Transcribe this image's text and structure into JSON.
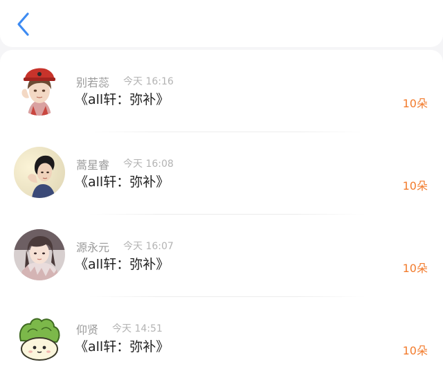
{
  "header": {
    "back_icon": "chevron-left-icon",
    "accent_color": "#3d8bf2"
  },
  "items": [
    {
      "name": "别若蕊",
      "time": "今天 16:16",
      "title": "《all轩：弥补》",
      "amount": "10朵",
      "avatar_icon": "avatar-boy-red-hat"
    },
    {
      "name": "蒿星睿",
      "time": "今天 16:08",
      "title": "《all轩：弥补》",
      "amount": "10朵",
      "avatar_icon": "avatar-woman-short-hair"
    },
    {
      "name": "源永元",
      "time": "今天 16:07",
      "title": "《all轩：弥补》",
      "amount": "10朵",
      "avatar_icon": "avatar-girl-bangs"
    },
    {
      "name": "仰贤",
      "time": "今天 14:51",
      "title": "《all轩：弥补》",
      "amount": "10朵",
      "avatar_icon": "avatar-cabbage-cartoon"
    }
  ],
  "colors": {
    "amount": "#f27b2c",
    "name": "#9a9a9a",
    "time": "#b3b3b3",
    "title": "#1f1f1f"
  }
}
